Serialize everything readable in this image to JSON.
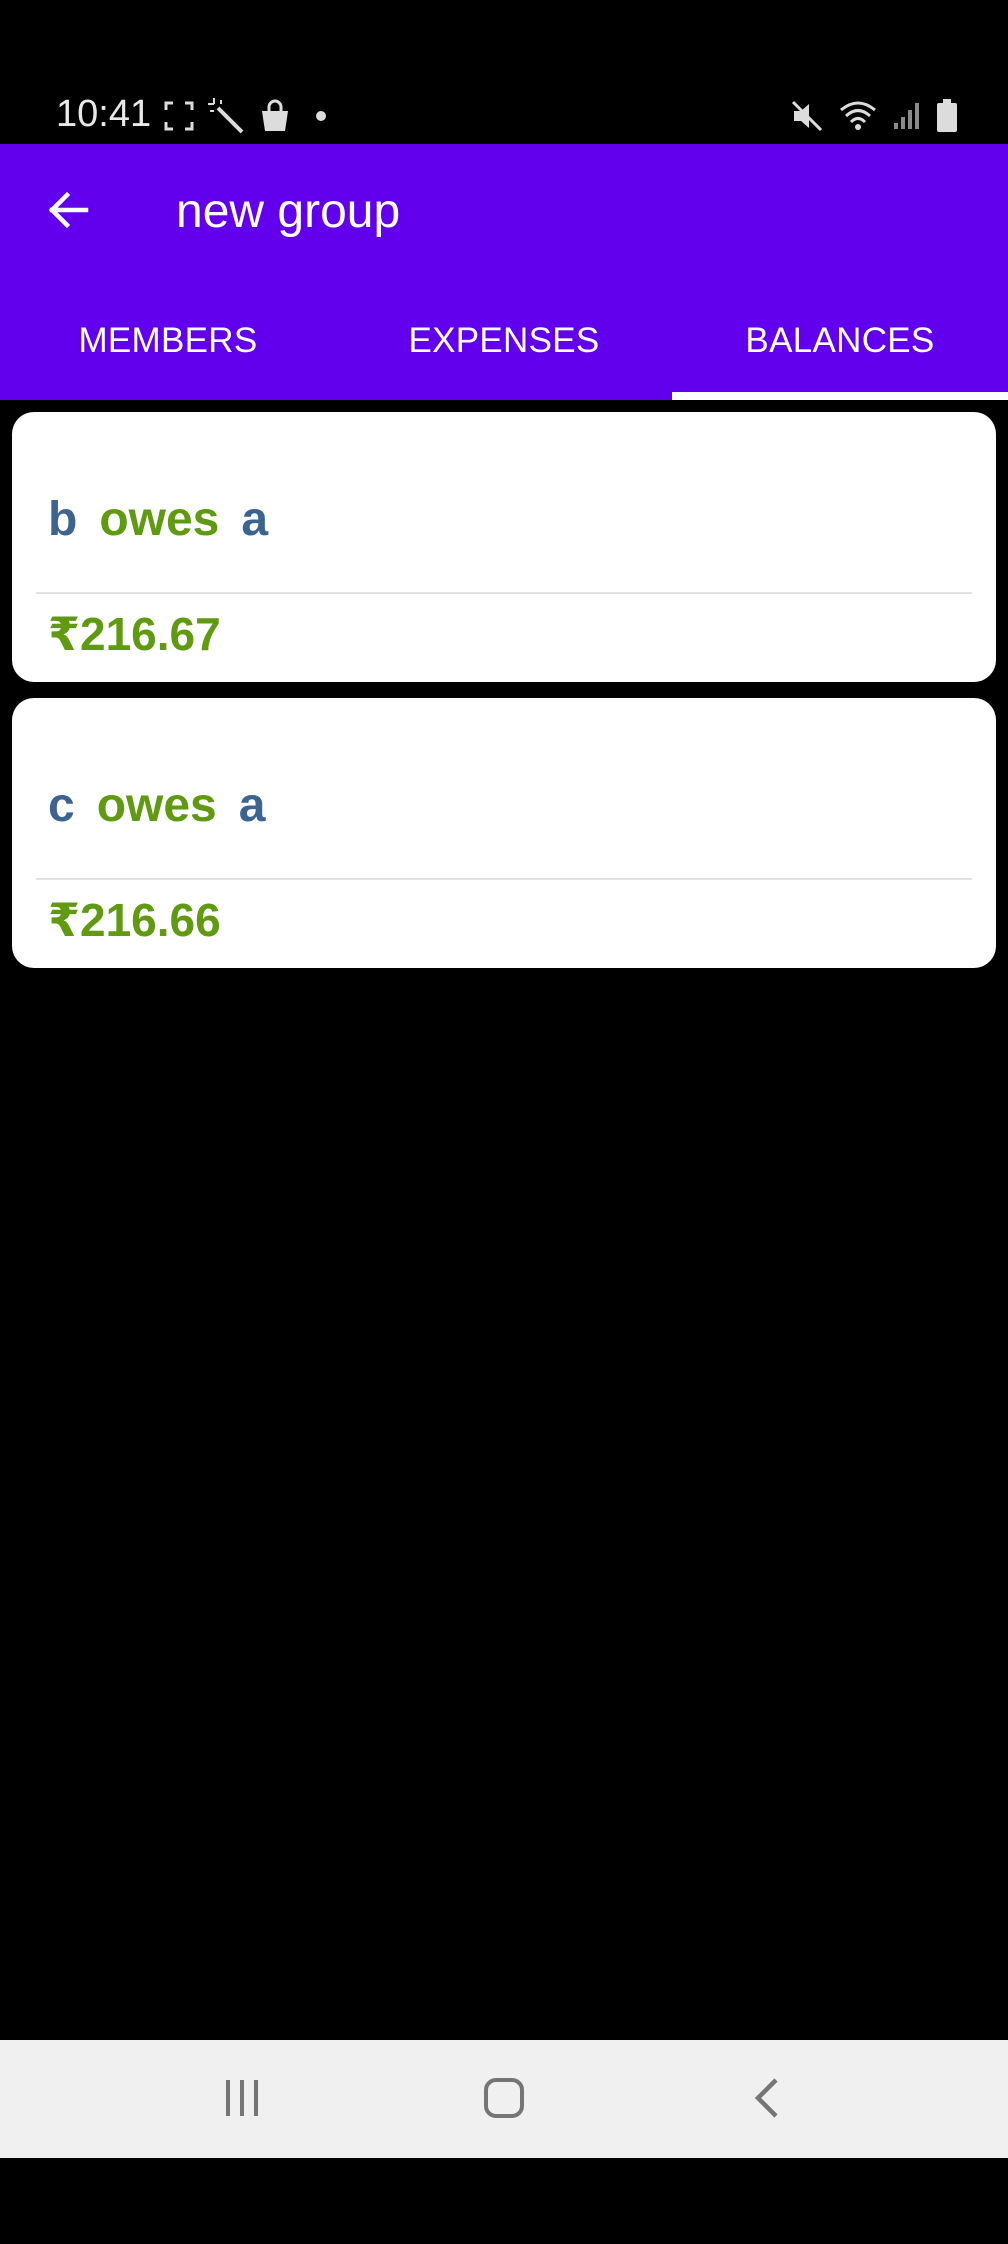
{
  "status_bar": {
    "time": "10:41",
    "left_icons": [
      "screenshot-frame-icon",
      "magic-wand-icon",
      "shopping-bag-icon",
      "notification-dot-icon"
    ],
    "right_icons": [
      "mute-icon",
      "wifi-icon",
      "signal-icon",
      "battery-icon"
    ]
  },
  "app_bar": {
    "title": "new group",
    "back_icon": "arrow-back-icon",
    "color": "#6200ee"
  },
  "tabs": [
    {
      "label": "MEMBERS",
      "selected": false
    },
    {
      "label": "EXPENSES",
      "selected": false
    },
    {
      "label": "BALANCES",
      "selected": true
    }
  ],
  "balances": [
    {
      "debtor": "b",
      "verb": "owes",
      "creditor": "a",
      "amount": "₹216.67"
    },
    {
      "debtor": "c",
      "verb": "owes",
      "creditor": "a",
      "amount": "₹216.66"
    }
  ],
  "colors": {
    "name": "#3d6491",
    "verb_and_amount": "#5f9a10"
  },
  "nav_bar": {
    "buttons": [
      "recent-apps-icon",
      "home-icon",
      "back-icon"
    ]
  }
}
